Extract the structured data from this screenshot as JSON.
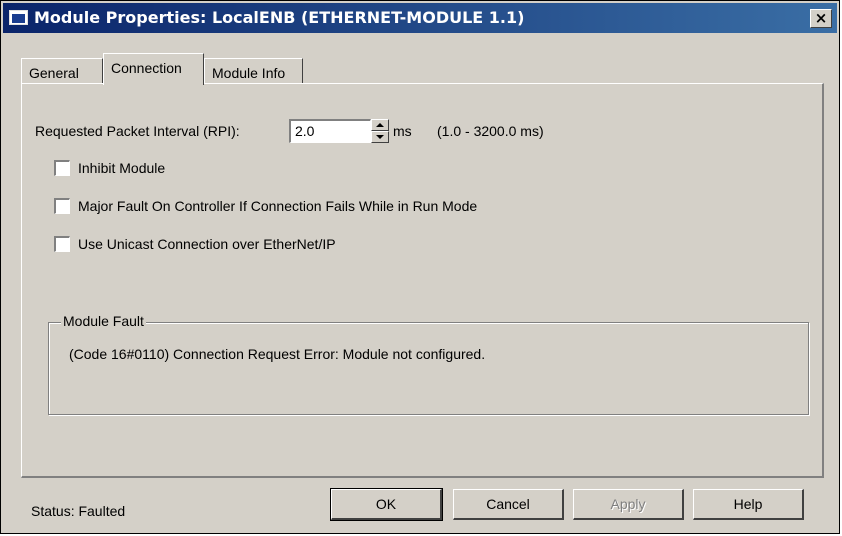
{
  "window": {
    "title": "Module Properties: LocalENB (ETHERNET-MODULE 1.1)",
    "close_glyph": "×"
  },
  "tabs": [
    {
      "label": "General",
      "active": false
    },
    {
      "label": "Connection",
      "active": true
    },
    {
      "label": "Module Info",
      "active": false
    }
  ],
  "connection": {
    "rpi_label": "Requested Packet Interval (RPI):",
    "rpi_value": "2.0",
    "rpi_unit": "ms",
    "rpi_range": "(1.0 - 3200.0 ms)",
    "inhibit_label": "Inhibit Module",
    "inhibit_checked": false,
    "major_fault_label": "Major Fault On Controller If Connection Fails While in Run Mode",
    "major_fault_checked": false,
    "unicast_label": "Use Unicast Connection over EtherNet/IP",
    "unicast_checked": false
  },
  "module_fault": {
    "legend": "Module Fault",
    "message": "(Code 16#0110) Connection Request Error: Module not configured."
  },
  "footer": {
    "status": "Status:  Faulted",
    "ok_label": "OK",
    "cancel_label": "Cancel",
    "apply_label": "Apply",
    "help_label": "Help"
  },
  "colors": {
    "title_bar": "#0a246a",
    "face": "#d4d0c8"
  }
}
